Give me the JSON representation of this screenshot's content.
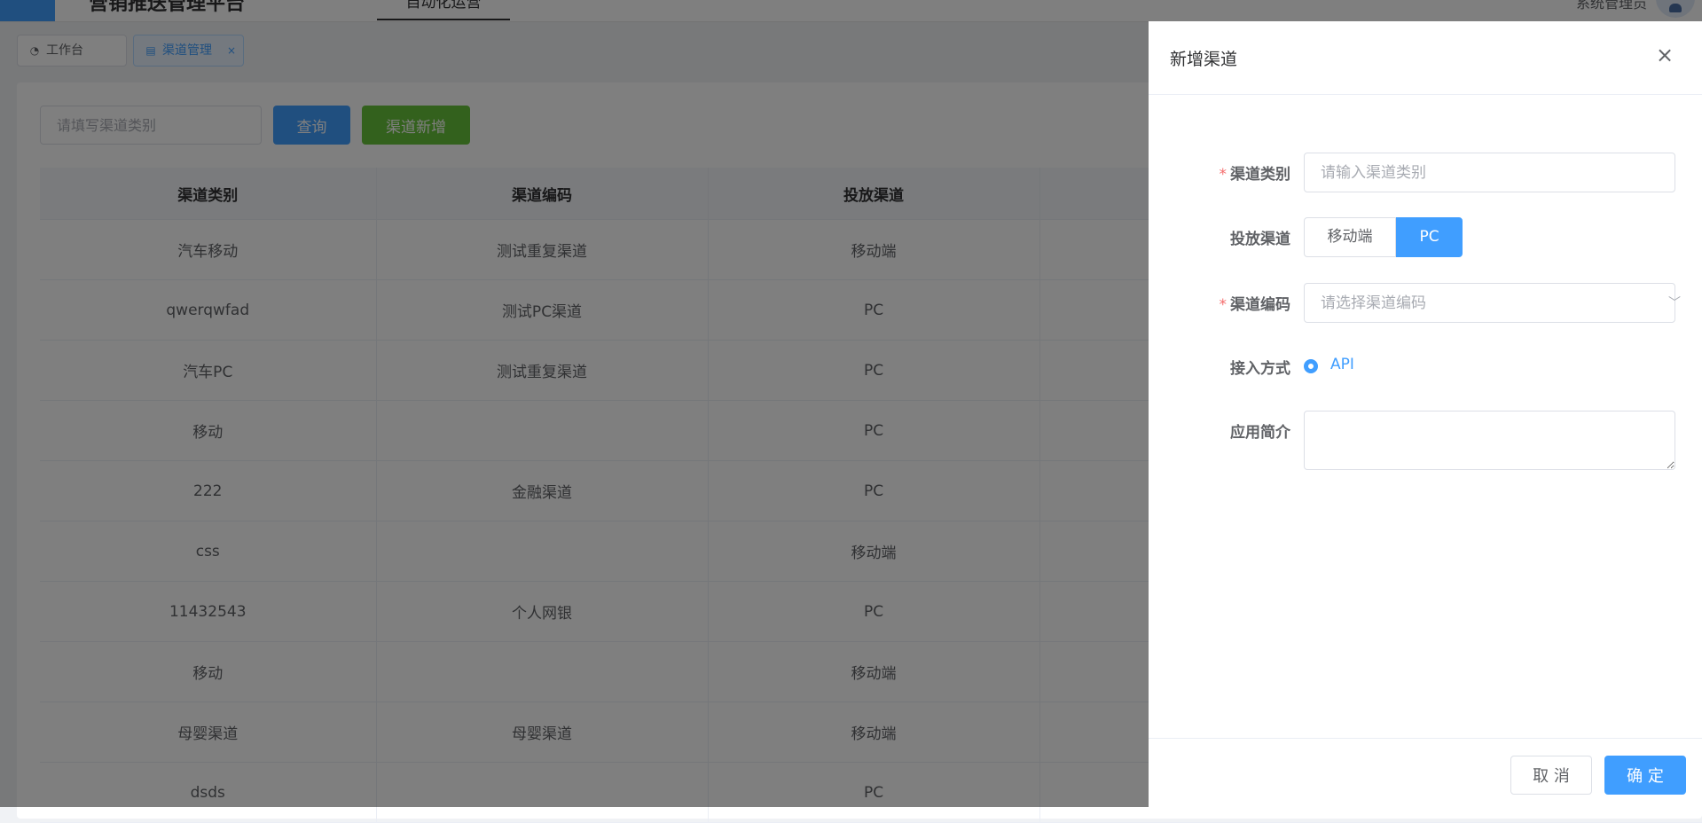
{
  "header": {
    "app_title": "营销推送管理平台",
    "nav_item": "自动化运营",
    "user_name": "系统管理员"
  },
  "tags": [
    {
      "label": "工作台",
      "icon": "dashboard-icon"
    },
    {
      "label": "渠道管理",
      "icon": "document-icon",
      "close": "×"
    }
  ],
  "search": {
    "placeholder": "请填写渠道类别",
    "query_label": "查询",
    "add_label": "渠道新增"
  },
  "table": {
    "columns": [
      "渠道类别",
      "渠道编码",
      "投放渠道",
      ""
    ],
    "rows": [
      [
        "汽车移动",
        "测试重复渠道",
        "移动端",
        ""
      ],
      [
        "qwerqwfad",
        "测试PC渠道",
        "PC",
        ""
      ],
      [
        "汽车PC",
        "测试重复渠道",
        "PC",
        ""
      ],
      [
        "移动",
        "",
        "PC",
        ""
      ],
      [
        "222",
        "金融渠道",
        "PC",
        ""
      ],
      [
        "css",
        "",
        "移动端",
        ""
      ],
      [
        "11432543",
        "个人网银",
        "PC",
        ""
      ],
      [
        "移动",
        "",
        "移动端",
        ""
      ],
      [
        "母婴渠道",
        "母婴渠道",
        "移动端",
        ""
      ],
      [
        "dsds",
        "",
        "PC",
        ""
      ]
    ]
  },
  "drawer": {
    "title": "新增渠道",
    "close": "×",
    "required_mark": "*",
    "fields": {
      "category_label": "渠道类别",
      "category_placeholder": "请输入渠道类别",
      "channel_label": "投放渠道",
      "channel_options": [
        "移动端",
        "PC"
      ],
      "channel_selected": "PC",
      "code_label": "渠道编码",
      "code_placeholder": "请选择渠道编码",
      "select_arrow": "﹀",
      "access_label": "接入方式",
      "access_option": "API",
      "intro_label": "应用简介"
    },
    "cancel_label": "取 消",
    "ok_label": "确 定"
  },
  "colors": {
    "primary": "#409eff",
    "success": "#67c23a",
    "danger": "#f56c6c",
    "overlay": "rgba(0,0,0,0.5)"
  }
}
